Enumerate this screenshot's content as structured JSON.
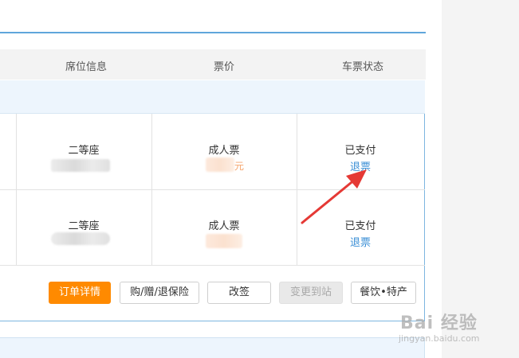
{
  "table_header": {
    "seat_info": "席位信息",
    "price": "票价",
    "ticket_status": "车票状态"
  },
  "rows": [
    {
      "seat_class": "二等座",
      "ticket_type": "成人票",
      "price_fragment": "元",
      "status": "已支付",
      "action": "退票"
    },
    {
      "seat_class": "二等座",
      "ticket_type": "成人票",
      "price_fragment": "",
      "status": "已支付",
      "action": "退票"
    }
  ],
  "actions": {
    "order_details": "订单详情",
    "buy_gift_refund_insurance": "购/赠/退保险",
    "change_ticket": "改签",
    "change_to_station": "变更到站",
    "food_specialties": "餐饮•特产"
  },
  "watermark": {
    "logo_text": "Bai 经验",
    "url": "jingyan.baidu.com"
  },
  "colors": {
    "accent_blue": "#3b8fd6",
    "primary_orange": "#ff8a00",
    "arrow_red": "#e53935"
  }
}
